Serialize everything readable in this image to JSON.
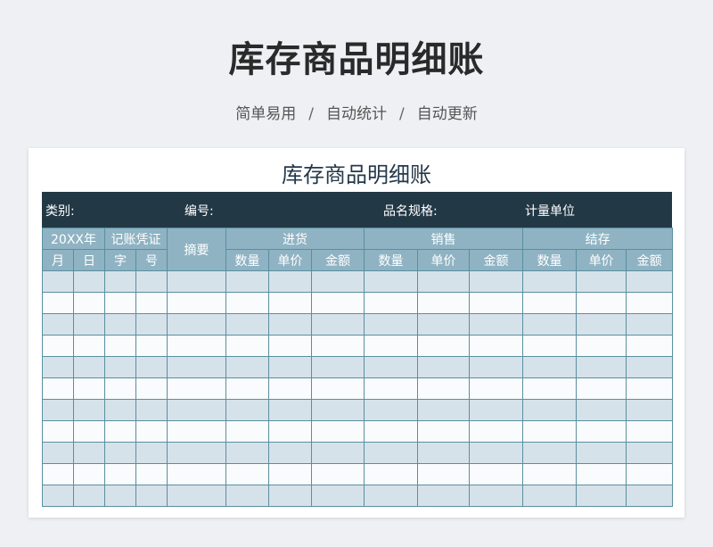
{
  "page": {
    "title": "库存商品明细账",
    "tagline": [
      "简单易用",
      "自动统计",
      "自动更新"
    ],
    "separator": "/"
  },
  "sheet": {
    "title": "库存商品明细账",
    "info": {
      "category": "类别:",
      "code": "编号:",
      "spec": "品名规格:",
      "unit": "计量单位"
    },
    "headers": {
      "year": "20XX年",
      "voucher": "记账凭证",
      "summary": "摘要",
      "in": "进货",
      "out": "销售",
      "balance": "结存",
      "month": "月",
      "day": "日",
      "char": "字",
      "num": "号",
      "qty": "数量",
      "price": "单价",
      "amount": "金额"
    },
    "row_count": 11
  },
  "colors": {
    "info_bar": "#233845",
    "header": "#8fb3c3",
    "border": "#5a8fa0",
    "row_odd": "#d6e2ea",
    "row_even": "#f9fbfc"
  }
}
